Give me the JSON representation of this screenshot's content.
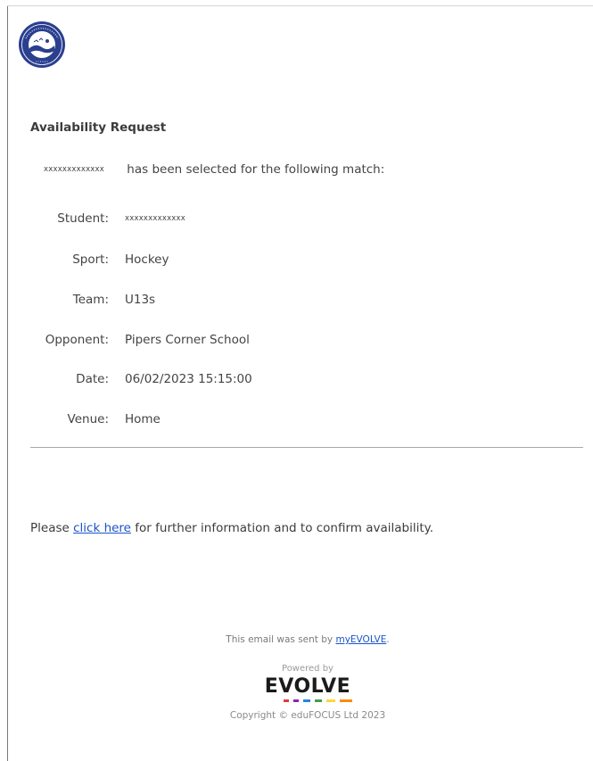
{
  "email": {
    "heading": "Availability Request",
    "student_masked": "xxxxxxxxxxxxx",
    "intro_text": "has been selected for the following match:",
    "details": [
      {
        "label": "Student:",
        "value": "xxxxxxxxxxxxx"
      },
      {
        "label": "Sport:",
        "value": "Hockey"
      },
      {
        "label": "Team:",
        "value": "U13s"
      },
      {
        "label": "Opponent:",
        "value": "Pipers Corner School"
      },
      {
        "label": "Date:",
        "value": "06/02/2023 15:15:00"
      },
      {
        "label": "Venue:",
        "value": "Home"
      }
    ],
    "cta_prefix": "Please",
    "cta_link": "click here",
    "cta_suffix": "for further information and to confirm availability."
  },
  "footer": {
    "sent_prefix": "This email was sent by",
    "sent_link": "myEVOLVE",
    "sent_suffix": ".",
    "powered_by": "Powered by",
    "brand": "EVOLVE",
    "brand_dot_colors": [
      "#e53935",
      "#8e24aa",
      "#1e88e5",
      "#43a047",
      "#fdd835",
      "#fb8c00"
    ],
    "copyright": "Copyright © eduFOCUS Ltd 2023"
  },
  "colors": {
    "link": "#1a53c9",
    "logo": "#2a3f8f"
  }
}
